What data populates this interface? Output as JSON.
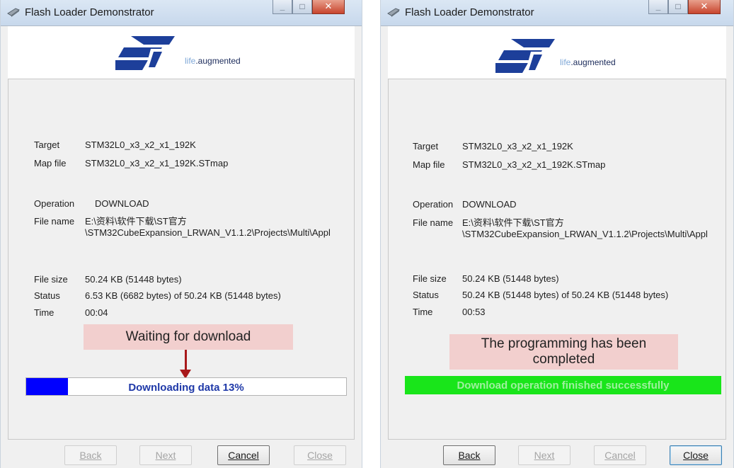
{
  "left": {
    "title": "Flash Loader Demonstrator",
    "tagline_life": "life",
    "tagline_rest": ".augmented",
    "fields": {
      "target_label": "Target",
      "target_value": "STM32L0_x3_x2_x1_192K",
      "mapfile_label": "Map file",
      "mapfile_value": "STM32L0_x3_x2_x1_192K.STmap",
      "operation_label": "Operation",
      "operation_value": "DOWNLOAD",
      "filename_label": "File name",
      "filename_line1": "E:\\资料\\软件下载\\ST官方",
      "filename_line2": "\\STM32CubeExpansion_LRWAN_V1.1.2\\Projects\\Multi\\Appl",
      "filesize_label": "File size",
      "filesize_value": "50.24 KB (51448 bytes)",
      "status_label": "Status",
      "status_value": "6.53 KB (6682 bytes) of 50.24 KB (51448 bytes)",
      "time_label": "Time",
      "time_value": "00:04"
    },
    "callout": "Waiting for download",
    "progress": {
      "text": "Downloading data 13%",
      "percent": 13,
      "fill_color": "#0000ff",
      "text_color": "#1f39a8"
    },
    "buttons": {
      "back": "Back",
      "next": "Next",
      "cancel": "Cancel",
      "close": "Close"
    }
  },
  "right": {
    "title": "Flash Loader Demonstrator",
    "tagline_life": "life",
    "tagline_rest": ".augmented",
    "fields": {
      "target_label": "Target",
      "target_value": "STM32L0_x3_x2_x1_192K",
      "mapfile_label": "Map file",
      "mapfile_value": "STM32L0_x3_x2_x1_192K.STmap",
      "operation_label": "Operation",
      "operation_value": "DOWNLOAD",
      "filename_label": "File name",
      "filename_line1": "E:\\资料\\软件下载\\ST官方",
      "filename_line2": "\\STM32CubeExpansion_LRWAN_V1.1.2\\Projects\\Multi\\Appl",
      "filesize_label": "File size",
      "filesize_value": "50.24 KB (51448 bytes)",
      "status_label": "Status",
      "status_value": "50.24 KB (51448 bytes) of 50.24 KB (51448 bytes)",
      "time_label": "Time",
      "time_value": "00:53"
    },
    "callout_line1": "The programming has been",
    "callout_line2": "completed",
    "progress": {
      "text": "Download operation finished successfully",
      "percent": 100,
      "fill_color": "#19e51a",
      "text_color": "#9ff09f"
    },
    "buttons": {
      "back": "Back",
      "next": "Next",
      "cancel": "Cancel",
      "close": "Close"
    }
  },
  "colors": {
    "callout_bg": "#f2cfce",
    "st_blue": "#1d3f9a",
    "arrow_red": "#a8191b"
  }
}
